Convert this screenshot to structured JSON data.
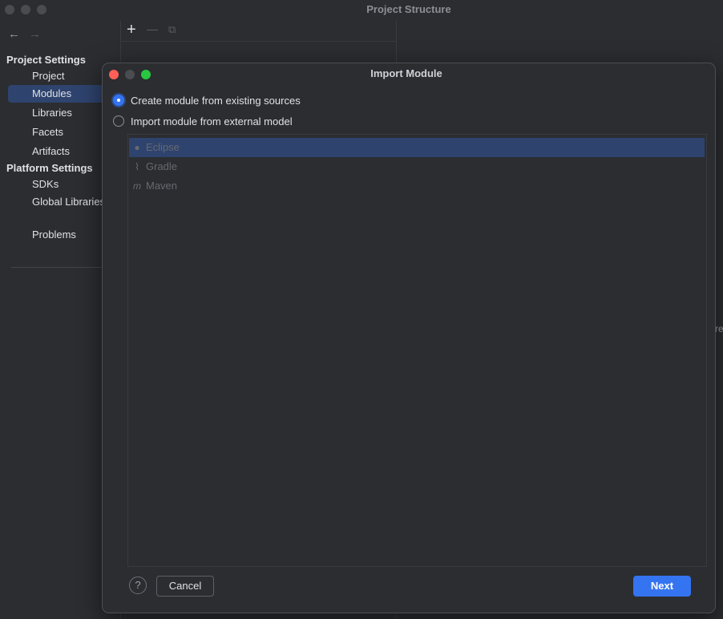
{
  "window": {
    "title": "Project Structure",
    "back_icon": "←",
    "forward_icon": "→"
  },
  "sidebar": {
    "project_settings_title": "Project Settings",
    "platform_settings_title": "Platform Settings",
    "items": [
      {
        "label": "Project",
        "selected": false
      },
      {
        "label": "Modules",
        "selected": true
      },
      {
        "label": "Libraries",
        "selected": false
      },
      {
        "label": "Facets",
        "selected": false
      },
      {
        "label": "Artifacts",
        "selected": false
      },
      {
        "label": "SDKs",
        "selected": false
      },
      {
        "label": "Global Libraries",
        "selected": false
      },
      {
        "label": "Problems",
        "selected": false
      }
    ]
  },
  "toolbar": {
    "add_icon": "+",
    "remove_icon": "—",
    "copy_icon": "⧉"
  },
  "background_fragment": "re",
  "dialog": {
    "title": "Import Module",
    "options": [
      {
        "label": "Create module from existing sources",
        "selected": true
      },
      {
        "label": "Import module from external model",
        "selected": false
      }
    ],
    "models": [
      {
        "label": "Eclipse",
        "icon": "eclipse-icon",
        "glyph": "●",
        "selected": true
      },
      {
        "label": "Gradle",
        "icon": "gradle-icon",
        "glyph": "⌇",
        "selected": false
      },
      {
        "label": "Maven",
        "icon": "maven-icon",
        "glyph": "m",
        "selected": false
      }
    ],
    "help_label": "?",
    "cancel_label": "Cancel",
    "next_label": "Next"
  },
  "colors": {
    "accent": "#3574f0",
    "selection": "#2e436e",
    "background": "#2b2d30",
    "close": "#ff5f57",
    "zoom": "#28c840"
  }
}
